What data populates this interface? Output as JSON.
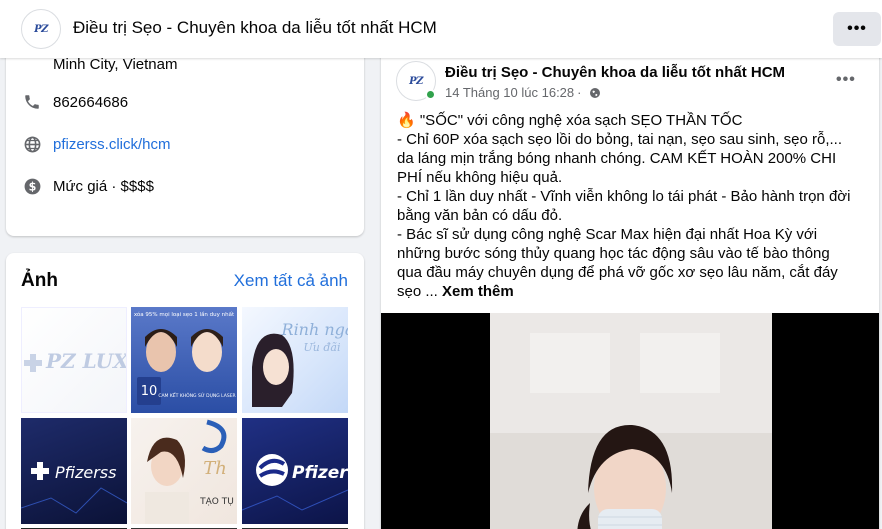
{
  "header": {
    "logo": "PZ",
    "title": "Điều trị Sẹo - Chuyên khoa da liễu tốt nhất HCM"
  },
  "intro": {
    "address": "Minh City, Vietnam",
    "phone": "862664686",
    "website": "pfizerss.click/hcm",
    "price": "Mức giá · $$$$"
  },
  "photos": {
    "heading": "Ảnh",
    "see_all": "Xem tất cả ảnh",
    "items": [
      {
        "name": "pz-luxury-logo",
        "text": "PZ LUXURY"
      },
      {
        "name": "before-after-ad",
        "text": "xóa 95% mọi loại sẹo 1 lần duy nhất",
        "caption": "CAM KẾT KHÔNG SỬ DỤNG LASER"
      },
      {
        "name": "promo-woman",
        "text": "Rinh ngà",
        "sub": "Ưu đãi"
      },
      {
        "name": "pfizerss-logo",
        "text": "Pfizerss"
      },
      {
        "name": "woman-promo-2",
        "text": "Th",
        "sub": "TẠO TỤ"
      },
      {
        "name": "pfizer-logo",
        "text": "Pfizer"
      }
    ]
  },
  "post": {
    "author": "Điều trị Sẹo - Chuyên khoa da liễu tốt nhất HCM",
    "time": "14 Tháng 10 lúc 16:28",
    "text_lines": [
      "\"SỐC\" với công nghệ xóa sạch SẸO THẦN TỐC",
      "- Chỉ 60P xóa sạch sẹo lồi do bỏng, tai nạn, sẹo sau sinh, sẹo rỗ,...",
      "da láng mịn trắng bóng nhanh chóng. CAM KẾT HOÀN 200% CHI",
      "PHÍ nếu không hiệu quả.",
      "- Chỉ 1 lần duy nhất - Vĩnh viễn không lo tái phát - Bảo hành trọn đời",
      "bằng văn bản có dấu đỏ.",
      " - Bác sĩ sử dụng công nghệ Scar Max hiện đại nhất Hoa Kỳ với",
      "những bước sóng thủy quang học tác động sâu vào tế bào thông",
      "qua đầu máy chuyên dụng để phá vỡ gốc xơ sẹo lâu năm, cắt đáy"
    ],
    "last_line": "sẹo ...",
    "see_more": "Xem thêm"
  }
}
